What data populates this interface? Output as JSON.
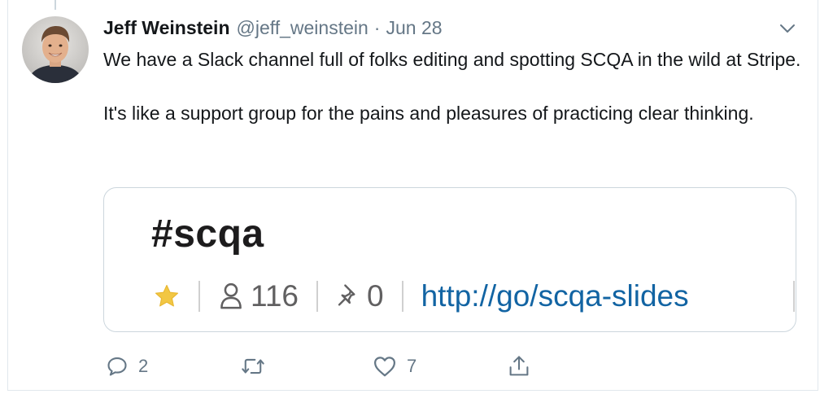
{
  "tweet": {
    "author_name": "Jeff Weinstein",
    "author_handle": "@jeff_weinstein",
    "separator": "·",
    "date": "Jun 28",
    "paragraphs": [
      "We have a Slack channel full of folks editing and spotting SCQA in the wild at Stripe.",
      "It's like a support group for the pains and pleasures of practicing clear thinking."
    ]
  },
  "card": {
    "channel_name": "#scqa",
    "member_count": "116",
    "pin_count": "0",
    "link_text": "http://go/scqa-slides"
  },
  "actions": {
    "reply_count": "2",
    "retweet_count": "",
    "like_count": "7"
  },
  "icons": {
    "reply": "reply-bubble-icon",
    "retweet": "retweet-icon",
    "like": "heart-icon",
    "share": "share-icon",
    "star": "star-icon",
    "members": "person-icon",
    "pins": "pin-icon",
    "caret": "chevron-down-icon"
  },
  "colors": {
    "name_text": "#14171a",
    "secondary_text": "#657786",
    "card_border": "#ccd6dd",
    "link_blue": "#1264a3",
    "star_yellow": "#f2c744"
  }
}
